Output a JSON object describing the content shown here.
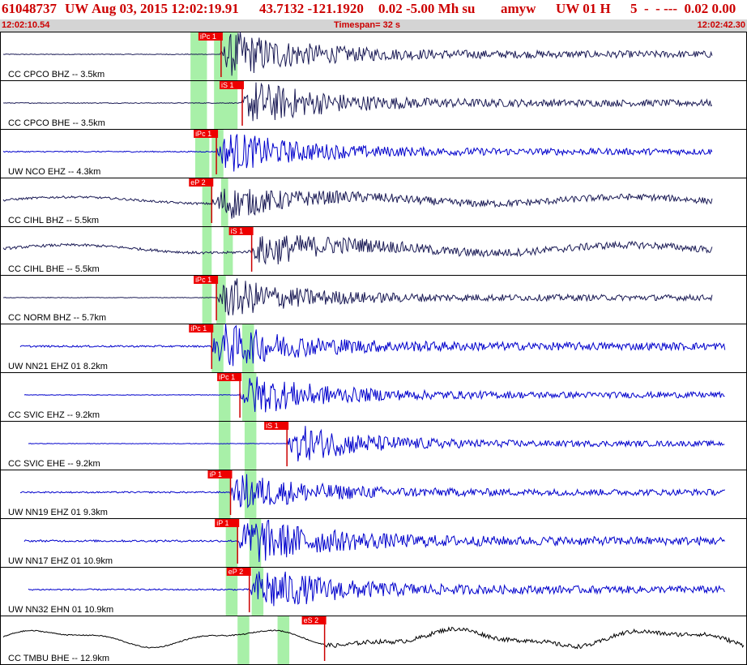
{
  "header": {
    "event_id": "61048737",
    "network": "UW",
    "datetime": "Aug 03, 2015 12:02:19.91",
    "location": "43.7132 -121.1920",
    "magnitude": "0.02 -5.00 Mh su",
    "author": "amyw",
    "source": "UW 01 H",
    "quality": "5  -  - ---  0.02 0.00"
  },
  "subheader": {
    "start_time": "12:02:10.54",
    "timespan": "Timespan=  32 s",
    "end_time": "12:02:42.30"
  },
  "colors": {
    "pick_box": "#ee0000",
    "pick_line": "#cc0000",
    "window": "#a8f0a8",
    "trace_dark": "#1a1a55",
    "trace_blue": "#0000cc",
    "trace_black": "#000000"
  },
  "traces": [
    {
      "label": "CC CPCO BHZ -- 3.5km",
      "color": "#1a1a55",
      "pick": "iPc 1",
      "pick_sec": 9.4,
      "windows_sec": [
        [
          8.1,
          8.8
        ],
        [
          9.1,
          10.1
        ]
      ],
      "amp": 0.58,
      "noise": 0.06
    },
    {
      "label": "CC CPCO BHE -- 3.5km",
      "color": "#1a1a55",
      "pick": "iS 1",
      "pick_sec": 10.3,
      "windows_sec": [
        [
          8.1,
          8.8
        ],
        [
          9.1,
          10.1
        ]
      ],
      "amp": 0.55,
      "noise": 0.07
    },
    {
      "label": "UW NCO EHZ -- 4.3km",
      "color": "#0000cc",
      "pick": "iPc 1",
      "pick_sec": 9.2,
      "windows_sec": [
        [
          8.3,
          8.9
        ],
        [
          9.0,
          9.5
        ]
      ],
      "amp": 0.5,
      "noise": 0.1
    },
    {
      "label": "CC CIHL BHZ -- 5.5km",
      "color": "#1a1a55",
      "pick": "eP 2",
      "pick_sec": 9.0,
      "windows_sec": [
        [
          8.6,
          9.0
        ],
        [
          9.4,
          9.7
        ]
      ],
      "amp": 0.45,
      "noise": 0.25
    },
    {
      "label": "CC CIHL BHE -- 5.5km",
      "color": "#1a1a55",
      "pick": "iS 1",
      "pick_sec": 10.7,
      "windows_sec": [
        [
          8.6,
          9.0
        ],
        [
          9.5,
          9.9
        ]
      ],
      "amp": 0.45,
      "noise": 0.3
    },
    {
      "label": "CC NORM BHZ -- 5.7km",
      "color": "#1a1a55",
      "pick": "iPc 1",
      "pick_sec": 9.2,
      "windows_sec": [
        [
          8.6,
          9.0
        ],
        [
          9.2,
          9.6
        ]
      ],
      "amp": 0.5,
      "noise": 0.05
    },
    {
      "label": "UW NN21 EHZ 01 8.2km",
      "color": "#0000cc",
      "pick": "iPc 1",
      "pick_sec": 9.0,
      "windows_sec": [
        [
          9.0,
          9.5
        ],
        [
          10.3,
          10.8
        ]
      ],
      "amp": 0.55,
      "noise": 0.15
    },
    {
      "label": "CC SVIC EHZ -- 9.2km",
      "color": "#0000cc",
      "pick": "iPc 1",
      "pick_sec": 10.2,
      "windows_sec": [
        [
          9.3,
          9.8
        ],
        [
          10.3,
          10.9
        ]
      ],
      "amp": 0.5,
      "noise": 0.05
    },
    {
      "label": "CC SVIC EHE -- 9.2km",
      "color": "#0000cc",
      "pick": "iS 1",
      "pick_sec": 12.2,
      "windows_sec": [
        [
          9.3,
          9.8
        ],
        [
          10.4,
          10.9
        ]
      ],
      "amp": 0.45,
      "noise": 0.05
    },
    {
      "label": "UW NN19 EHZ 01 9.3km",
      "color": "#0000cc",
      "pick": "iP 1",
      "pick_sec": 9.8,
      "windows_sec": [
        [
          9.3,
          9.8
        ],
        [
          10.4,
          10.9
        ]
      ],
      "amp": 0.45,
      "noise": 0.15
    },
    {
      "label": "UW NN17 EHZ 01 10.9km",
      "color": "#0000cc",
      "pick": "iP 1",
      "pick_sec": 10.1,
      "windows_sec": [
        [
          9.6,
          10.1
        ],
        [
          10.6,
          11.1
        ]
      ],
      "amp": 0.6,
      "noise": 0.15
    },
    {
      "label": "UW NN32 EHN 01 10.9km",
      "color": "#0000cc",
      "pick": "eP 2",
      "pick_sec": 10.6,
      "windows_sec": [
        [
          9.6,
          10.1
        ],
        [
          10.7,
          11.2
        ]
      ],
      "amp": 0.55,
      "noise": 0.12
    },
    {
      "label": "CC TMBU BHE -- 12.9km",
      "color": "#000000",
      "pick": "eS 2",
      "pick_sec": 13.8,
      "windows_sec": [
        [
          10.1,
          10.6
        ],
        [
          11.8,
          12.3
        ]
      ],
      "amp": 0.35,
      "noise": 0.5
    }
  ]
}
